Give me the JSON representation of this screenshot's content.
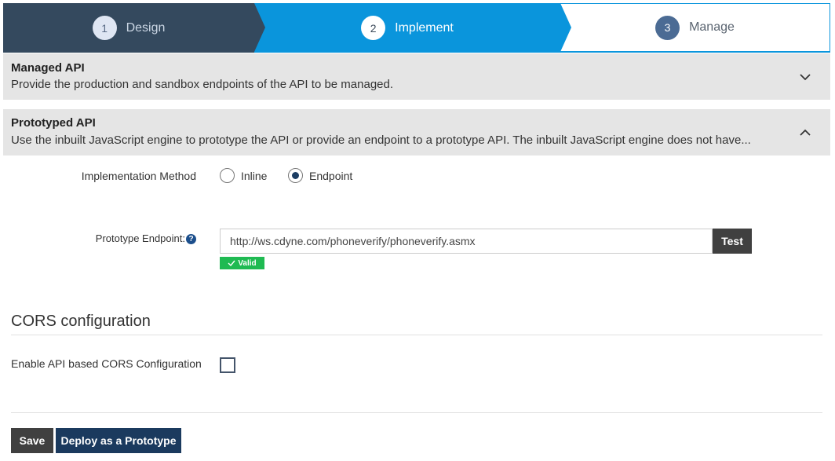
{
  "wizard": {
    "steps": [
      {
        "number": "1",
        "label": "Design",
        "state": "completed"
      },
      {
        "number": "2",
        "label": "Implement",
        "state": "active"
      },
      {
        "number": "3",
        "label": "Manage",
        "state": "pending"
      }
    ]
  },
  "panels": {
    "managed": {
      "title": "Managed API",
      "description": "Provide the production and sandbox endpoints of the API to be managed.",
      "icon": "chevron-down-icon"
    },
    "prototyped": {
      "title": "Prototyped API",
      "description": "Use the inbuilt JavaScript engine to prototype the API or provide an endpoint to a prototype API. The inbuilt JavaScript engine does not have...",
      "icon": "chevron-up-icon"
    }
  },
  "implementation": {
    "label": "Implementation Method",
    "options": [
      {
        "label": "Inline",
        "selected": false
      },
      {
        "label": "Endpoint",
        "selected": true
      }
    ]
  },
  "endpoint": {
    "label": "Prototype Endpoint:",
    "help_icon": "?",
    "value": "http://ws.cdyne.com/phoneverify/phoneverify.asmx",
    "test_label": "Test",
    "valid_label": "Valid"
  },
  "cors": {
    "title": "CORS configuration",
    "enable_label": "Enable API based CORS Configuration",
    "enabled": false
  },
  "actions": {
    "save_label": "Save",
    "deploy_label": "Deploy as a Prototype"
  },
  "colors": {
    "completed": "#34495e",
    "active": "#0a95dc",
    "valid": "#1fba52",
    "primary_button": "#1b3a5e",
    "secondary_button": "#404040"
  }
}
